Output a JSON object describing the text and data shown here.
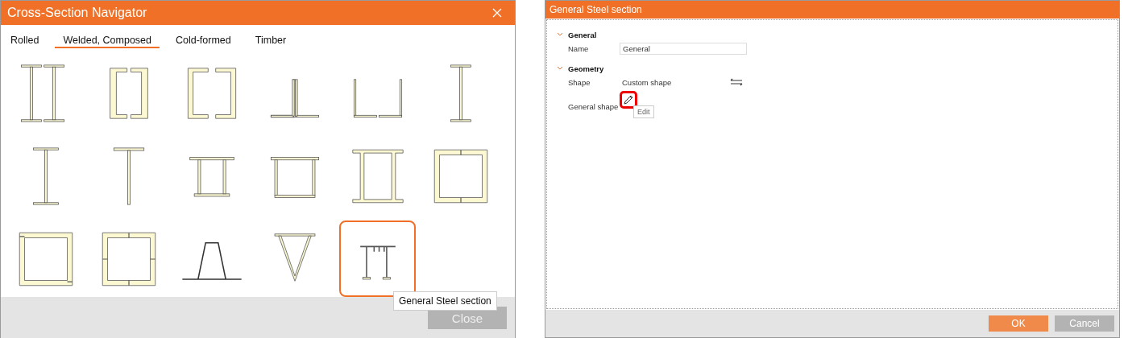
{
  "navigator": {
    "title": "Cross-Section Navigator",
    "tabs": [
      {
        "label": "Rolled",
        "selected": false
      },
      {
        "label": "Welded, Composed",
        "selected": true
      },
      {
        "label": "Cold-formed",
        "selected": false
      },
      {
        "label": "Timber",
        "selected": false
      }
    ],
    "sections": [
      {
        "kind": "double-i",
        "selected": false
      },
      {
        "kind": "double-channel",
        "selected": false
      },
      {
        "kind": "channel-box",
        "selected": false
      },
      {
        "kind": "angle-t",
        "selected": false
      },
      {
        "kind": "angle-u",
        "selected": false
      },
      {
        "kind": "i-beam",
        "selected": false
      },
      {
        "kind": "welded-i",
        "selected": false
      },
      {
        "kind": "welded-t",
        "selected": false
      },
      {
        "kind": "box-narrow",
        "selected": false
      },
      {
        "kind": "box-wide",
        "selected": false
      },
      {
        "kind": "i-box",
        "selected": false
      },
      {
        "kind": "channel-square",
        "selected": false
      },
      {
        "kind": "channel-angle-square",
        "selected": false
      },
      {
        "kind": "angle-square",
        "selected": false
      },
      {
        "kind": "trapezoid",
        "selected": false
      },
      {
        "kind": "triangle",
        "selected": false
      },
      {
        "kind": "general",
        "selected": true
      }
    ],
    "tooltip": "General Steel section",
    "close_button": "Close"
  },
  "editor": {
    "title": "General Steel section",
    "groups": [
      {
        "title": "General",
        "expanded": true,
        "rows": [
          {
            "kind": "field",
            "label": "Name",
            "value": "General"
          }
        ]
      },
      {
        "title": "Geometry",
        "expanded": true,
        "rows": [
          {
            "kind": "choice",
            "label": "Shape",
            "value": "Custom shape"
          },
          {
            "kind": "edit",
            "label": "General shape",
            "highlighted": true,
            "tooltip": "Edit"
          }
        ]
      }
    ],
    "ok_button": "OK",
    "cancel_button": "Cancel"
  }
}
